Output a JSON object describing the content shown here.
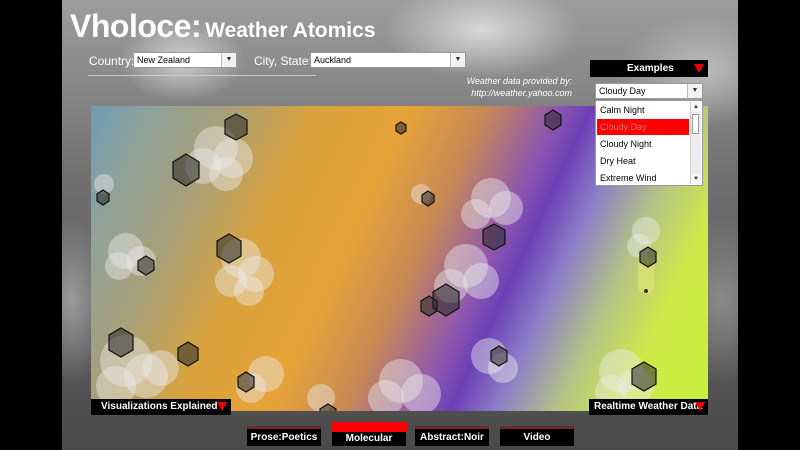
{
  "app": {
    "brand": "Vholoce:",
    "subtitle": "Weather Atomics"
  },
  "location": {
    "country_label": "Country:",
    "country_value": "New Zealand",
    "city_label": "City, State:",
    "city_value": "Auckland"
  },
  "credit": {
    "line1": "Weather data provided by:",
    "line2": "http://weather.yahoo.com"
  },
  "examples": {
    "header": "Examples",
    "selected": "Cloudy Day",
    "options": [
      "Calm Night",
      "Cloudy Day",
      "Cloudy Night",
      "Dry Heat",
      "Extreme Wind"
    ]
  },
  "footer": {
    "explained": "Visualizations Explained",
    "realtime": "Realtime Weather Data"
  },
  "tabs": [
    "Prose:Poetics",
    "Molecular",
    "Abstract:Noir",
    "Video"
  ],
  "active_tab": "Molecular",
  "colors": {
    "accent": "#ff0000",
    "text": "#ffffff",
    "panel": "#000000"
  },
  "icons": {
    "dropdown": "chevron-down-icon",
    "toggle": "red-triangle-icon"
  }
}
